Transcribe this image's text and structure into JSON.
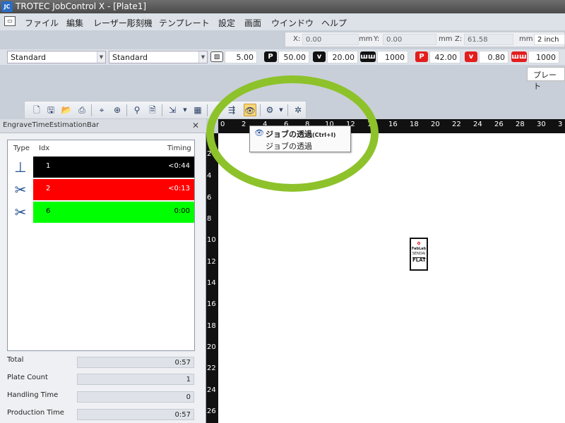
{
  "window": {
    "title": "TROTEC JobControl X - [Plate1]",
    "logo": "JC"
  },
  "menu": [
    "ファイル",
    "編集",
    "レーザー彫刻機",
    "テンプレート",
    "設定",
    "画面",
    "ウインドウ",
    "ヘルプ"
  ],
  "coords": {
    "x_label": "X:",
    "x": "0.00",
    "x_unit": "mm",
    "y_label": "Y:",
    "y": "0.00",
    "y_unit": "mm",
    "z_label": "Z:",
    "z": "61.58",
    "z_unit": "mm",
    "lens": "2 inch"
  },
  "props": {
    "material": "Standard",
    "template": "Standard",
    "thickness": "5.00",
    "p1_badge": "P",
    "p1": "50.00",
    "v1_badge": "v",
    "v1": "20.00",
    "f1": "1000",
    "p2_badge": "P",
    "p2": "42.00",
    "v2_badge": "v",
    "v2": "0.80",
    "f2": "1000"
  },
  "plate_button": "プレート",
  "panel": {
    "title": "EngraveTimeEstimationBar",
    "columns": {
      "type": "Type",
      "idx": "Idx",
      "timing": "Timing"
    },
    "rows": [
      {
        "type_icon": "engrave-icon",
        "idx": "1",
        "timing": "<0:44",
        "color": "#000000",
        "text_color": "#ffffff"
      },
      {
        "type_icon": "cut-icon",
        "idx": "2",
        "timing": "<0:13",
        "color": "#ff0000",
        "text_color": "#ffffff"
      },
      {
        "type_icon": "cut-icon",
        "idx": "6",
        "timing": "0:00",
        "color": "#00ff00",
        "text_color": "#000000"
      }
    ],
    "summary": [
      {
        "label": "Total",
        "value": "0:57"
      },
      {
        "label": "Plate Count",
        "value": "1"
      },
      {
        "label": "Handling Time",
        "value": "0"
      },
      {
        "label": "Production Time",
        "value": "0:57"
      }
    ]
  },
  "ruler_h": [
    "0",
    "2",
    "4",
    "6",
    "8",
    "10",
    "12",
    "14",
    "16",
    "18",
    "20",
    "22",
    "24",
    "26",
    "28",
    "30",
    "3"
  ],
  "ruler_v": [
    "2",
    "4",
    "6",
    "8",
    "10",
    "12",
    "14",
    "16",
    "18",
    "20",
    "22",
    "24",
    "26"
  ],
  "tooltip": {
    "title": "ジョブの透過",
    "shortcut": "(Ctrl+I)",
    "desc": "ジョブの透過"
  },
  "job_item": {
    "line1": "FabLab",
    "line2": "SENDAI",
    "line3": "FLAT"
  },
  "colors": {
    "highlight_ring": "#8dc22b",
    "active_button": "#f8d67a"
  }
}
